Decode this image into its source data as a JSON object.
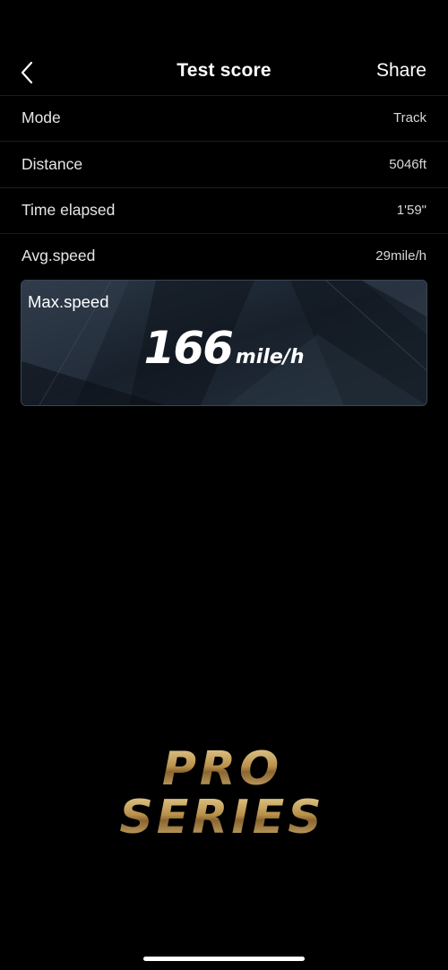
{
  "nav": {
    "title": "Test score",
    "share_label": "Share"
  },
  "rows": [
    {
      "label": "Mode",
      "value": "Track"
    },
    {
      "label": "Distance",
      "value": "5046ft"
    },
    {
      "label": "Time elapsed",
      "value": "1'59\""
    },
    {
      "label": "Avg.speed",
      "value": "29mile/h"
    }
  ],
  "max_speed": {
    "label": "Max.speed",
    "value": "166",
    "unit": "mile/h"
  },
  "logo": {
    "line1": "PRO",
    "line2": "SERIES"
  },
  "colors": {
    "background": "#000000",
    "card": "#1d2632",
    "logo_gold": "#c9a45a"
  },
  "icons": {
    "back": "chevron-left-icon"
  }
}
